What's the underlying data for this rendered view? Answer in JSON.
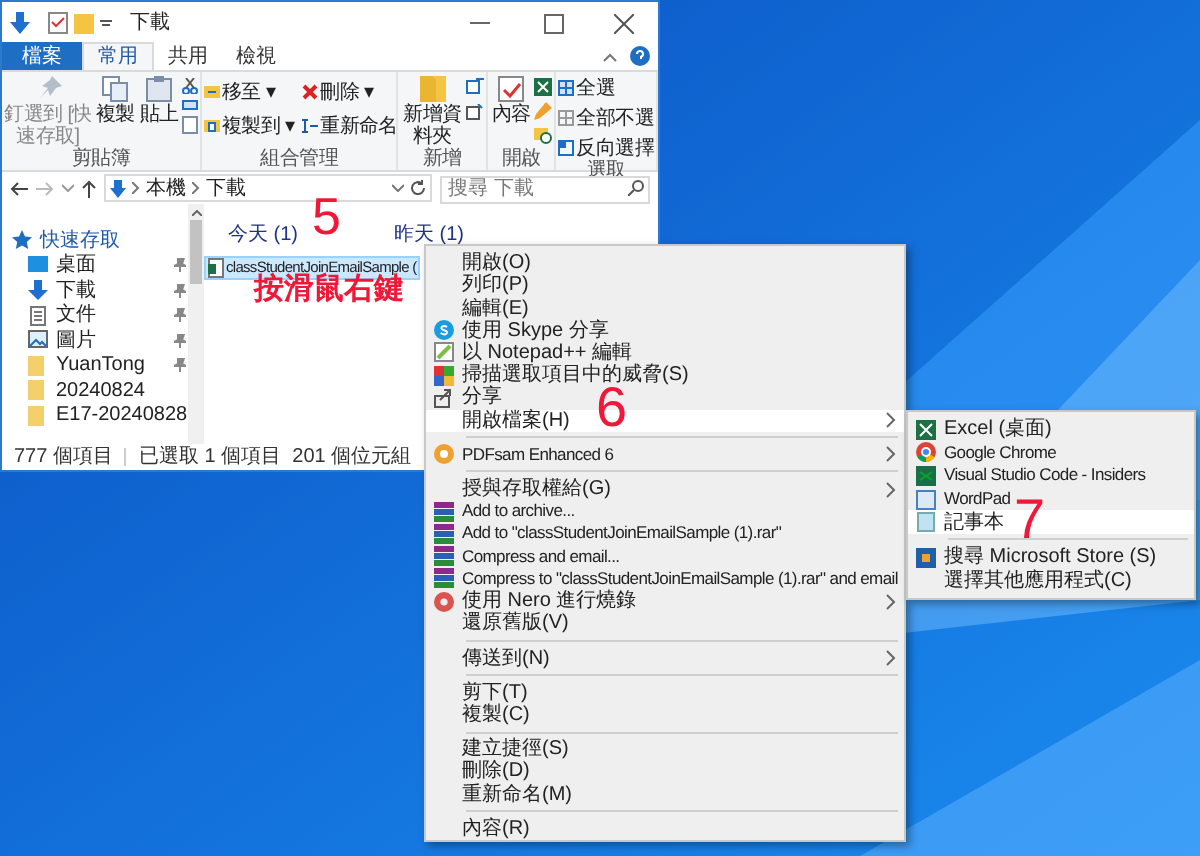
{
  "explorer": {
    "title": "下載",
    "ribbon_tabs": [
      {
        "label": "檔案",
        "selected": false,
        "kind": "file"
      },
      {
        "label": "常用",
        "selected": true,
        "kind": "tab"
      },
      {
        "label": "共用",
        "selected": false,
        "kind": "tab"
      },
      {
        "label": "檢視",
        "selected": false,
        "kind": "tab"
      }
    ],
    "ribbon_groups": [
      {
        "label": "剪貼簿",
        "buttons": [
          {
            "label": "釘選到 [快速存取]",
            "kind": "large",
            "disabled": true
          },
          {
            "label": "複製",
            "kind": "large",
            "disabled": false
          },
          {
            "label": "貼上",
            "kind": "large",
            "disabled": false
          }
        ]
      },
      {
        "label": "組合管理",
        "buttons": [
          {
            "label": "移至 ▾",
            "kind": "small",
            "disabled": false
          },
          {
            "label": "刪除 ▾",
            "kind": "small",
            "disabled": false
          },
          {
            "label": "複製到 ▾",
            "kind": "small",
            "disabled": false
          },
          {
            "label": "重新命名",
            "kind": "small",
            "disabled": false
          }
        ]
      },
      {
        "label": "新增",
        "buttons": [
          {
            "label": "新增資料夾",
            "kind": "large",
            "disabled": false
          }
        ]
      },
      {
        "label": "開啟",
        "buttons": [
          {
            "label": "內容",
            "kind": "large",
            "disabled": false
          }
        ]
      },
      {
        "label": "選取",
        "buttons": [
          {
            "label": "全選",
            "kind": "small",
            "disabled": false
          },
          {
            "label": "全部不選",
            "kind": "small",
            "disabled": false
          },
          {
            "label": "反向選擇",
            "kind": "small",
            "disabled": false
          }
        ]
      }
    ],
    "breadcrumb": [
      "本機",
      "下載"
    ],
    "search": {
      "placeholder": "搜尋 下載"
    },
    "nav_items": [
      {
        "label": "快速存取",
        "kind": "star",
        "pinned": false
      },
      {
        "label": "桌面",
        "kind": "desktop",
        "pinned": true
      },
      {
        "label": "下載",
        "kind": "download",
        "pinned": true
      },
      {
        "label": "文件",
        "kind": "doc",
        "pinned": true
      },
      {
        "label": "圖片",
        "kind": "picture",
        "pinned": true
      },
      {
        "label": "YuanTong",
        "kind": "folder",
        "pinned": true
      },
      {
        "label": "20240824",
        "kind": "folder",
        "pinned": false
      },
      {
        "label": "E17-20240828",
        "kind": "folder",
        "pinned": false
      }
    ],
    "groups": [
      {
        "heading": "今天 (1)"
      },
      {
        "heading": "昨天 (1)"
      }
    ],
    "file": {
      "name": "classStudentJoinEmailSample (",
      "selected": true
    },
    "status_bar": [
      "777 個項目",
      "已選取 1 個項目  201 個位元組"
    ]
  },
  "context_menu": [
    {
      "kind": "item",
      "label": "開啟(O)",
      "selected": false,
      "submenu": false
    },
    {
      "kind": "item",
      "label": "列印(P)",
      "selected": false,
      "submenu": false
    },
    {
      "kind": "item",
      "label": "編輯(E)",
      "selected": false,
      "submenu": false
    },
    {
      "kind": "item",
      "label": "使用 Skype 分享",
      "selected": false,
      "submenu": false
    },
    {
      "kind": "item",
      "label": "以 Notepad++ 編輯",
      "selected": false,
      "submenu": false
    },
    {
      "kind": "item",
      "label": "掃描選取項目中的威脅(S)",
      "selected": false,
      "submenu": false
    },
    {
      "kind": "item",
      "label": "分享",
      "selected": false,
      "submenu": false
    },
    {
      "kind": "item",
      "label": "開啟檔案(H)",
      "selected": true,
      "submenu": true
    },
    {
      "kind": "separator"
    },
    {
      "kind": "item",
      "label": "PDFsam Enhanced 6",
      "selected": false,
      "submenu": true
    },
    {
      "kind": "separator"
    },
    {
      "kind": "item",
      "label": "授與存取權給(G)",
      "selected": false,
      "submenu": true
    },
    {
      "kind": "item",
      "label": "Add to archive...",
      "selected": false,
      "submenu": false
    },
    {
      "kind": "item",
      "label": "Add to \"classStudentJoinEmailSample (1).rar\"",
      "selected": false,
      "submenu": false
    },
    {
      "kind": "item",
      "label": "Compress and email...",
      "selected": false,
      "submenu": false
    },
    {
      "kind": "item",
      "label": "Compress to \"classStudentJoinEmailSample (1).rar\" and email",
      "selected": false,
      "submenu": false
    },
    {
      "kind": "item",
      "label": "使用 Nero 進行燒錄",
      "selected": false,
      "submenu": true
    },
    {
      "kind": "item",
      "label": "還原舊版(V)",
      "selected": false,
      "submenu": false
    },
    {
      "kind": "separator"
    },
    {
      "kind": "item",
      "label": "傳送到(N)",
      "selected": false,
      "submenu": true
    },
    {
      "kind": "separator"
    },
    {
      "kind": "item",
      "label": "剪下(T)",
      "selected": false,
      "submenu": false
    },
    {
      "kind": "item",
      "label": "複製(C)",
      "selected": false,
      "submenu": false
    },
    {
      "kind": "separator"
    },
    {
      "kind": "item",
      "label": "建立捷徑(S)",
      "selected": false,
      "submenu": false
    },
    {
      "kind": "item",
      "label": "刪除(D)",
      "selected": false,
      "submenu": false
    },
    {
      "kind": "item",
      "label": "重新命名(M)",
      "selected": false,
      "submenu": false
    },
    {
      "kind": "separator"
    },
    {
      "kind": "item",
      "label": "內容(R)",
      "selected": false,
      "submenu": false
    }
  ],
  "open_with_menu": [
    {
      "kind": "item",
      "label": "Excel (桌面)",
      "selected": false
    },
    {
      "kind": "item",
      "label": "Google Chrome",
      "selected": false
    },
    {
      "kind": "item",
      "label": "Visual Studio Code - Insiders",
      "selected": false
    },
    {
      "kind": "item",
      "label": "WordPad",
      "selected": false
    },
    {
      "kind": "item",
      "label": "記事本",
      "selected": true
    },
    {
      "kind": "separator"
    },
    {
      "kind": "item",
      "label": "搜尋 Microsoft Store (S)",
      "selected": false
    },
    {
      "kind": "item",
      "label": "選擇其他應用程式(C)",
      "selected": false
    }
  ],
  "annotations": [
    {
      "text": "5"
    },
    {
      "text": "按滑鼠右鍵"
    },
    {
      "text": "6"
    },
    {
      "text": "7"
    }
  ]
}
